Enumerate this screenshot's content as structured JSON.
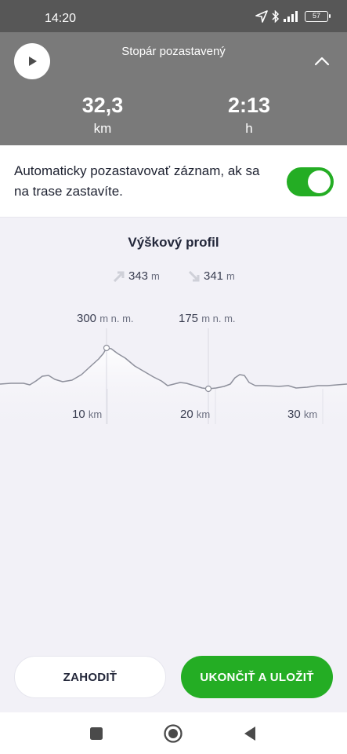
{
  "status_bar": {
    "time": "14:20",
    "battery": "57",
    "icons": [
      "location-arrow-icon",
      "bluetooth-icon",
      "signal-icon",
      "battery-icon"
    ]
  },
  "tracker": {
    "title": "Stopár pozastavený",
    "distance_value": "32,3",
    "distance_unit": "km",
    "time_value": "2:13",
    "time_unit": "h"
  },
  "autopause": {
    "text": "Automaticky pozastavovať záznam, ak sa na trase zastavíte.",
    "enabled": true
  },
  "profile": {
    "title": "Výškový profil",
    "ascent_value": "343",
    "ascent_unit": "m",
    "descent_value": "341",
    "descent_unit": "m",
    "peak_high_value": "300",
    "peak_low_value": "175",
    "peak_unit": "m n. m.",
    "km_unit": "km",
    "km_marks": [
      "10",
      "20",
      "30"
    ]
  },
  "actions": {
    "discard_label": "ZAHODIŤ",
    "save_label": "UKONČIŤ A ULOŽIŤ"
  },
  "colors": {
    "accent": "#24ad24",
    "header": "#7a7a7a",
    "status_bar": "#575757"
  }
}
